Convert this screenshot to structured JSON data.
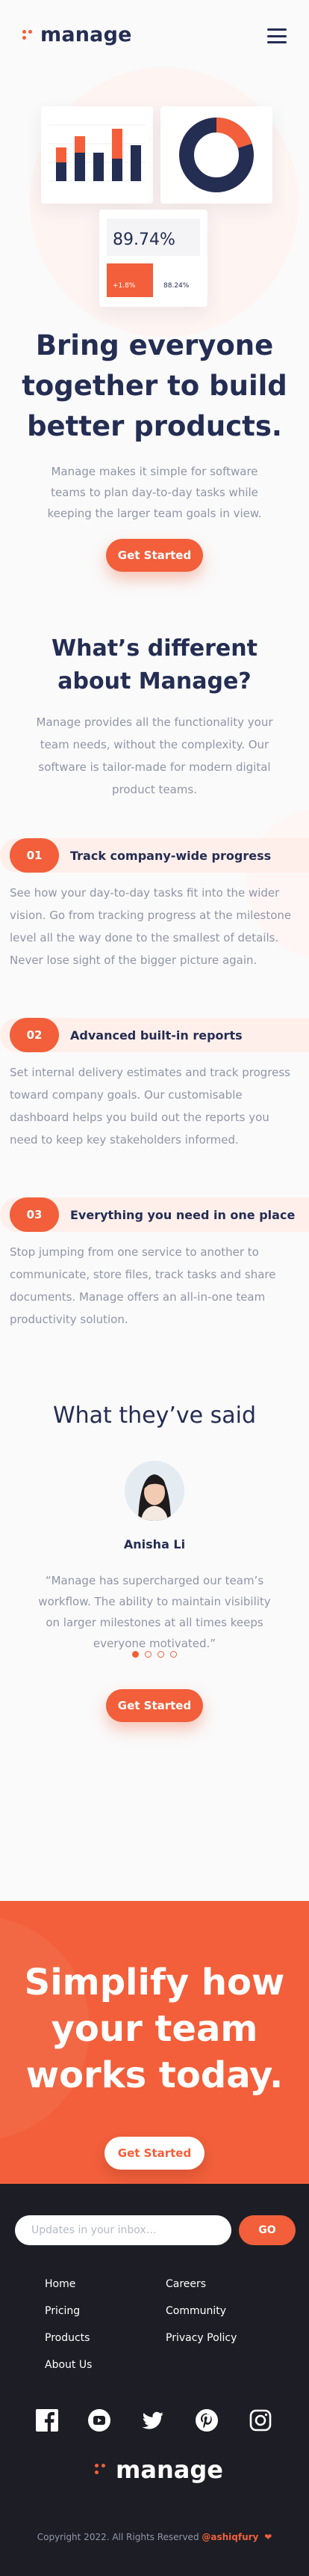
{
  "header": {
    "logo_text": "manage",
    "menu_icon": "hamburger-icon"
  },
  "hero": {
    "stat_big": "89.74%",
    "stat_small_badge": "+1.8%",
    "stat_small_value": "88.24%",
    "title_lines": [
      "Bring everyone",
      "together to build",
      "better products."
    ],
    "description_lines": [
      "Manage makes it simple for software",
      "teams to plan day-to-day tasks while",
      "keeping the larger team goals in view."
    ],
    "cta_label": "Get Started"
  },
  "different": {
    "title_lines": [
      "What’s different",
      "about Manage?"
    ],
    "description_lines": [
      "Manage provides all the functionality your",
      "team needs, without the complexity. Our",
      "software is tailor-made for modern digital",
      "product teams."
    ]
  },
  "features": [
    {
      "num": "01",
      "title": "Track company-wide progress",
      "lines": [
        "See how your day-to-day tasks fit into the wider",
        "vision. Go from tracking progress at the milestone",
        "level all the way done to the smallest of details.",
        "Never lose sight of the bigger picture again."
      ]
    },
    {
      "num": "02",
      "title": "Advanced built-in reports",
      "lines": [
        "Set internal delivery estimates and track progress",
        "toward company goals. Our customisable",
        "dashboard helps you build out the reports you",
        "need to keep key stakeholders informed."
      ]
    },
    {
      "num": "03",
      "title": "Everything you need in one place",
      "lines": [
        "Stop jumping from one service to another to",
        "communicate, store files, track tasks and share",
        "documents. Manage offers an all-in-one team",
        "productivity solution."
      ]
    }
  ],
  "testimonials": {
    "title": "What they’ve said",
    "name": "Anisha Li",
    "quote_lines": [
      "“Manage has supercharged our team’s",
      "workflow. The ability to maintain visibility",
      "on larger milestones at all times keeps",
      "everyone motivated.”"
    ],
    "slide_count": 4,
    "active_slide": 1,
    "cta_label": "Get Started"
  },
  "cta": {
    "title_lines": [
      "Simplify how",
      "your team",
      "works today."
    ],
    "button_label": "Get Started"
  },
  "footer": {
    "newsletter_placeholder": "Updates in your inbox…",
    "go_label": "GO",
    "links_left": [
      "Home",
      "Pricing",
      "Products",
      "About Us"
    ],
    "links_right": [
      "Careers",
      "Community",
      "Privacy Policy"
    ],
    "social": [
      "facebook-icon",
      "youtube-icon",
      "twitter-icon",
      "pinterest-icon",
      "instagram-icon"
    ],
    "logo_text": "manage",
    "copyright_text": "Copyright 2022. All Rights Reserved ",
    "copyright_author": "@ashiqfury",
    "heart": "❤"
  },
  "colors": {
    "accent": "#f25f3a",
    "accent_tint": "#ffefeb",
    "navy": "#242d52",
    "muted": "#9095a7",
    "footer_bg": "#1d1e25"
  }
}
